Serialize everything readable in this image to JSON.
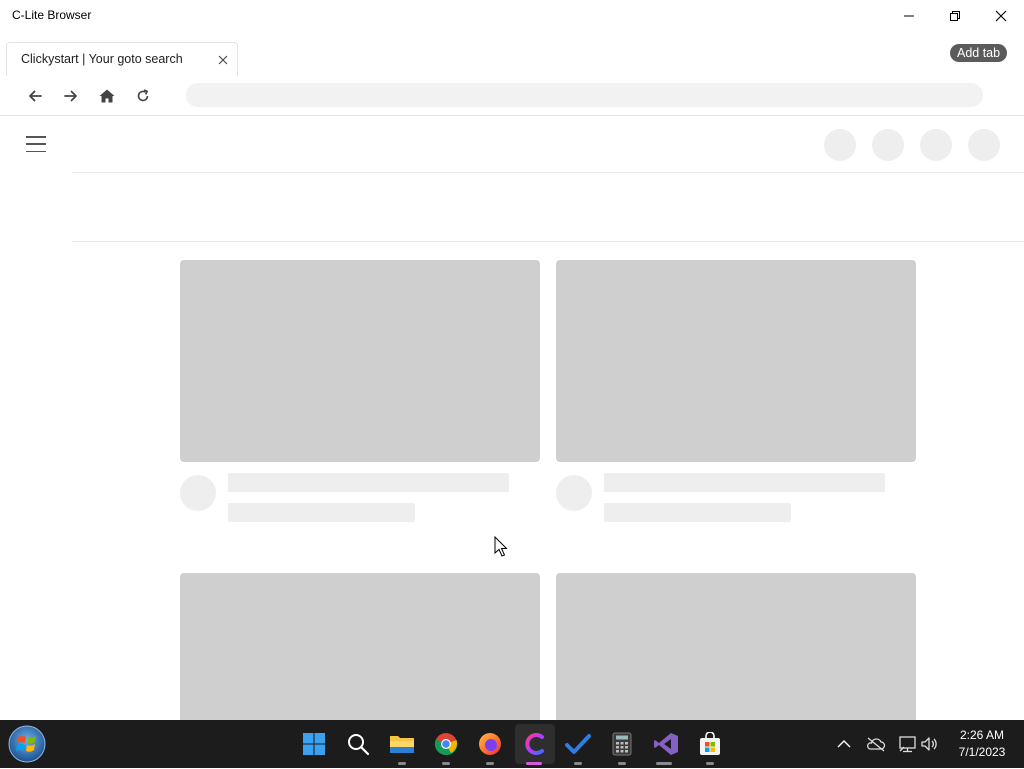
{
  "window": {
    "title": "C-Lite Browser"
  },
  "tabs": [
    {
      "label": "Clickystart | Your goto search",
      "active": true
    }
  ],
  "toolbar": {
    "add_tab_label": "Add tab",
    "address_value": ""
  },
  "taskbar": {
    "pinned": [
      "start",
      "search",
      "file-explorer",
      "chrome",
      "firefox",
      "c-lite-browser",
      "todo",
      "calculator",
      "visual-studio",
      "store"
    ],
    "active_app": "c-lite-browser"
  },
  "clock": {
    "time": "2:26 AM",
    "date": "7/1/2023"
  },
  "colors": {
    "skeleton": "#cfcfcf",
    "skeleton_light": "#eeeeee",
    "taskbar": "#1c1c1c",
    "add_tab_bg": "#5b5b5b"
  }
}
